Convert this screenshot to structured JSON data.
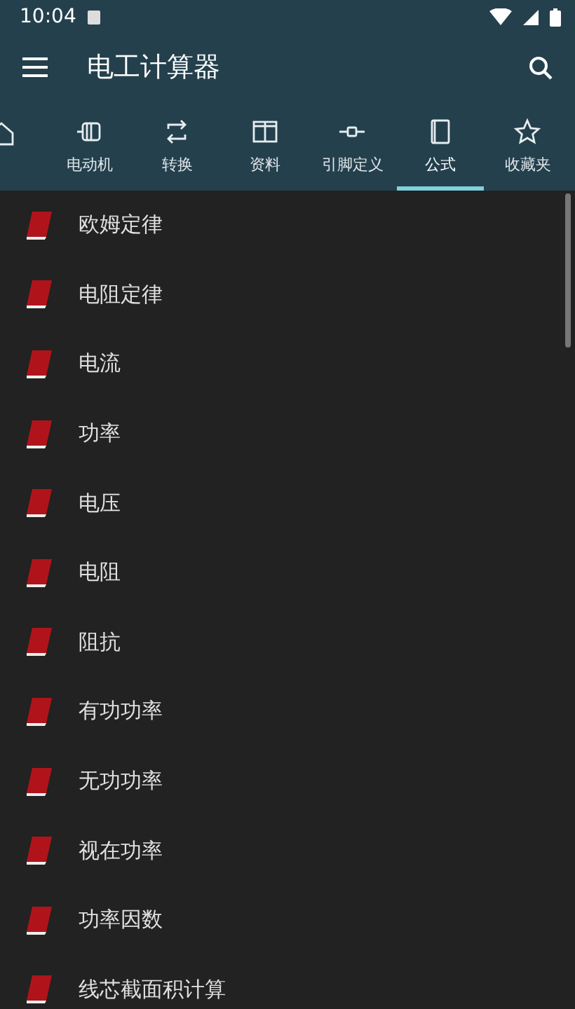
{
  "status_bar": {
    "time": "10:04"
  },
  "toolbar": {
    "title": "电工计算器"
  },
  "tabs": [
    {
      "selected": false
    },
    {
      "label": "电动机",
      "selected": false
    },
    {
      "label": "转换",
      "selected": false
    },
    {
      "label": "资料",
      "selected": false
    },
    {
      "label": "引脚定义",
      "selected": false
    },
    {
      "label": "公式",
      "selected": true
    },
    {
      "label": "收藏夹",
      "selected": false
    }
  ],
  "items": [
    "欧姆定律",
    "电阻定律",
    "电流",
    "功率",
    "电压",
    "电阻",
    "阻抗",
    "有功功率",
    "无功功率",
    "视在功率",
    "功率因数",
    "线芯截面积计算"
  ]
}
